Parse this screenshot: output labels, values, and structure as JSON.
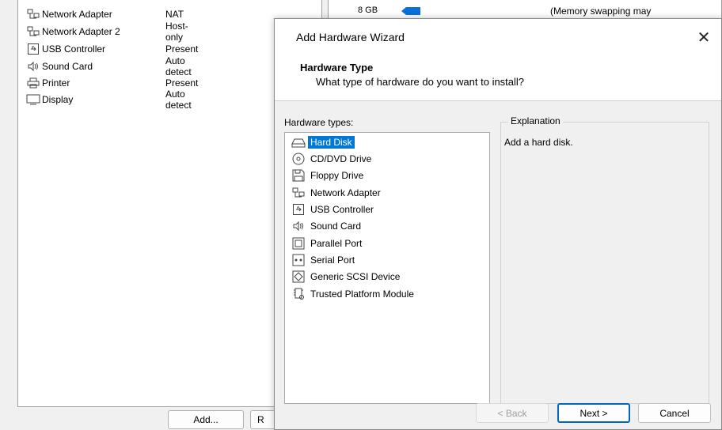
{
  "settings": {
    "devices": [
      {
        "icon": "network-adapter-icon",
        "name": "Network Adapter",
        "summary": "NAT"
      },
      {
        "icon": "network-adapter-icon",
        "name": "Network Adapter 2",
        "summary": "Host-only"
      },
      {
        "icon": "usb-controller-icon",
        "name": "USB Controller",
        "summary": "Present"
      },
      {
        "icon": "sound-card-icon",
        "name": "Sound Card",
        "summary": "Auto detect"
      },
      {
        "icon": "printer-icon",
        "name": "Printer",
        "summary": "Present"
      },
      {
        "icon": "display-icon",
        "name": "Display",
        "summary": "Auto detect"
      }
    ],
    "add_button": "Add...",
    "remove_button_partial": "R",
    "memory": {
      "marker_label": "8 GB",
      "note": "(Memory swapping may",
      "marker_color": "#0a6fd6"
    }
  },
  "dialog": {
    "title": "Add Hardware Wizard",
    "close_glyph": "✕",
    "header_title": "Hardware Type",
    "header_subtitle": "What type of hardware do you want to install?",
    "types_label": "Hardware types:",
    "types": [
      {
        "icon": "hard-disk-icon",
        "label": "Hard Disk",
        "selected": true
      },
      {
        "icon": "cd-dvd-drive-icon",
        "label": "CD/DVD Drive"
      },
      {
        "icon": "floppy-drive-icon",
        "label": "Floppy Drive"
      },
      {
        "icon": "network-adapter-icon",
        "label": "Network Adapter"
      },
      {
        "icon": "usb-controller-icon",
        "label": "USB Controller"
      },
      {
        "icon": "sound-card-icon",
        "label": "Sound Card"
      },
      {
        "icon": "parallel-port-icon",
        "label": "Parallel Port"
      },
      {
        "icon": "serial-port-icon",
        "label": "Serial Port"
      },
      {
        "icon": "generic-scsi-device-icon",
        "label": "Generic SCSI Device"
      },
      {
        "icon": "trusted-platform-module-icon",
        "label": "Trusted Platform Module"
      }
    ],
    "explanation_label": "Explanation",
    "explanation_text": "Add a hard disk.",
    "buttons": {
      "back": "< Back",
      "next": "Next >",
      "cancel": "Cancel"
    },
    "accent_color": "#0078d7"
  }
}
